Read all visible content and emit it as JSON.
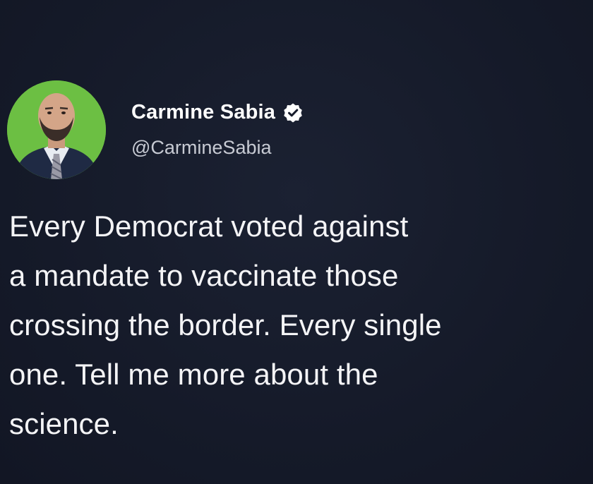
{
  "tweet": {
    "author": {
      "display_name": "Carmine Sabia",
      "handle": "@CarmineSabia",
      "avatar_icon": "profile-photo",
      "verified_icon": "verified-badge-icon"
    },
    "text": "Every Democrat voted against\na mandate to vaccinate those\ncrossing the border. Every single\none. Tell me more about the\nscience."
  },
  "colors": {
    "background": "#151a2a",
    "text": "#ffffff",
    "handle": "#c7cad3",
    "avatar_bg": "#6cbf43"
  }
}
